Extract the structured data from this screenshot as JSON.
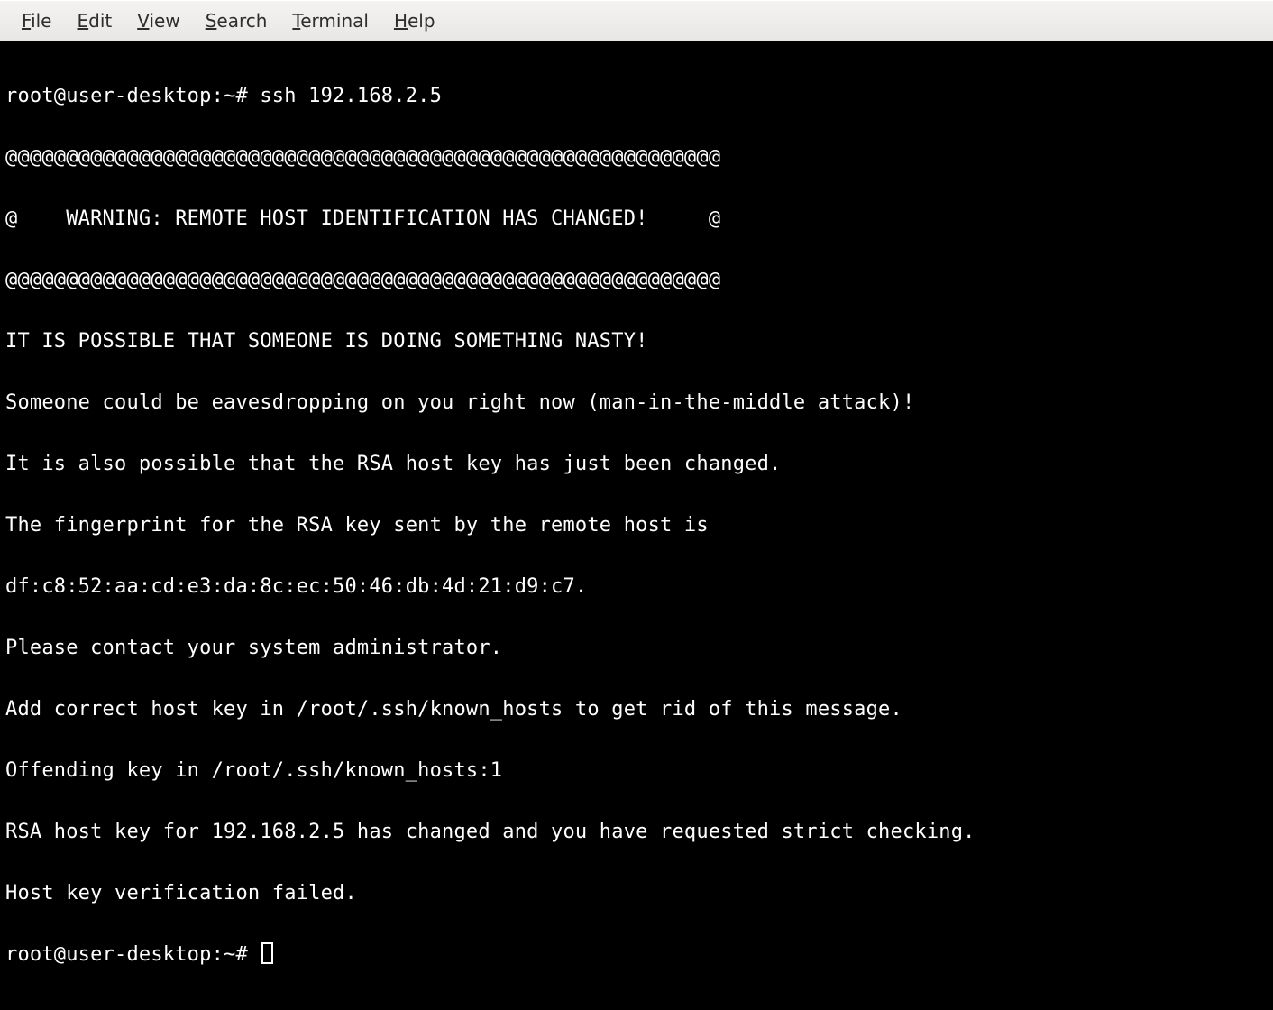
{
  "menubar": {
    "items": [
      {
        "label": "File",
        "mnemonic_index": 0
      },
      {
        "label": "Edit",
        "mnemonic_index": 0
      },
      {
        "label": "View",
        "mnemonic_index": 0
      },
      {
        "label": "Search",
        "mnemonic_index": 0
      },
      {
        "label": "Terminal",
        "mnemonic_index": 0
      },
      {
        "label": "Help",
        "mnemonic_index": 0
      }
    ]
  },
  "terminal": {
    "prompt1": "root@user-desktop:~# ",
    "command": "ssh 192.168.2.5",
    "border": "@@@@@@@@@@@@@@@@@@@@@@@@@@@@@@@@@@@@@@@@@@@@@@@@@@@@@@@@@@@",
    "warning_line": "@    WARNING: REMOTE HOST IDENTIFICATION HAS CHANGED!     @",
    "lines": [
      "IT IS POSSIBLE THAT SOMEONE IS DOING SOMETHING NASTY!",
      "Someone could be eavesdropping on you right now (man-in-the-middle attack)!",
      "It is also possible that the RSA host key has just been changed.",
      "The fingerprint for the RSA key sent by the remote host is",
      "df:c8:52:aa:cd:e3:da:8c:ec:50:46:db:4d:21:d9:c7.",
      "Please contact your system administrator.",
      "Add correct host key in /root/.ssh/known_hosts to get rid of this message.",
      "Offending key in /root/.ssh/known_hosts:1",
      "RSA host key for 192.168.2.5 has changed and you have requested strict checking.",
      "Host key verification failed."
    ],
    "prompt2": "root@user-desktop:~# "
  }
}
